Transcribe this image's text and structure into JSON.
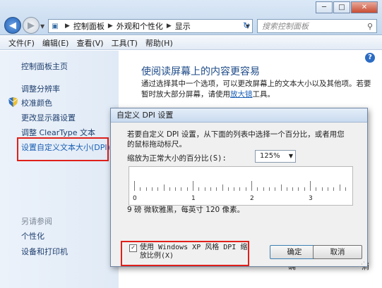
{
  "window": {
    "minimize": "─",
    "maximize": "□",
    "close": "✕"
  },
  "nav": {
    "back_glyph": "◀",
    "forward_glyph": "▶",
    "dropdown_glyph": "▼"
  },
  "address": {
    "breadcrumbs": [
      "控制面板",
      "外观和个性化",
      "显示"
    ],
    "separator": "▶",
    "refresh_glyph": "↻"
  },
  "search": {
    "placeholder": "搜索控制面板",
    "icon": "search-icon"
  },
  "menu": {
    "items": [
      "文件(F)",
      "编辑(E)",
      "查看(V)",
      "工具(T)",
      "帮助(H)"
    ]
  },
  "sidebar": {
    "home": "控制面板主页",
    "items": [
      "调整分辨率",
      "校准颜色",
      "更改显示器设置",
      "调整 ClearType 文本",
      "设置自定义文本大小(DPI)"
    ],
    "see_also_title": "另请参阅",
    "see_also": [
      "个性化",
      "设备和打印机"
    ]
  },
  "main": {
    "help": "?",
    "title": "使阅读屏幕上的内容更容易",
    "text_before_link": "通过选择其中一个选项，可以更改屏幕上的文本大小以及其他项。若要暂时放大部分屏幕，请使用",
    "link": "放大镜",
    "text_after_link": "工具。"
  },
  "dialog": {
    "title": "自定义 DPI 设置",
    "description": "若要自定义 DPI 设置，从下面的列表中选择一个百分比，或者用您的鼠标拖动标尺。",
    "scale_label": "缩放为正常大小的百分比(S):",
    "scale_value": "125%",
    "ruler_numbers": [
      "0",
      "1",
      "2",
      "3"
    ],
    "font_info": "9 磅 微软雅黑，每英寸 120 像素。",
    "checkbox_label": "使用 Windows XP 风格 DPI 缩放比例(X)",
    "checkbox_checked": true,
    "ok": "确定",
    "cancel": "取消"
  },
  "background_fragments": [
    "确",
    "消"
  ],
  "colors": {
    "highlight_box": "#e0201a",
    "link": "#1a5fb4",
    "title": "#1e4b88"
  }
}
